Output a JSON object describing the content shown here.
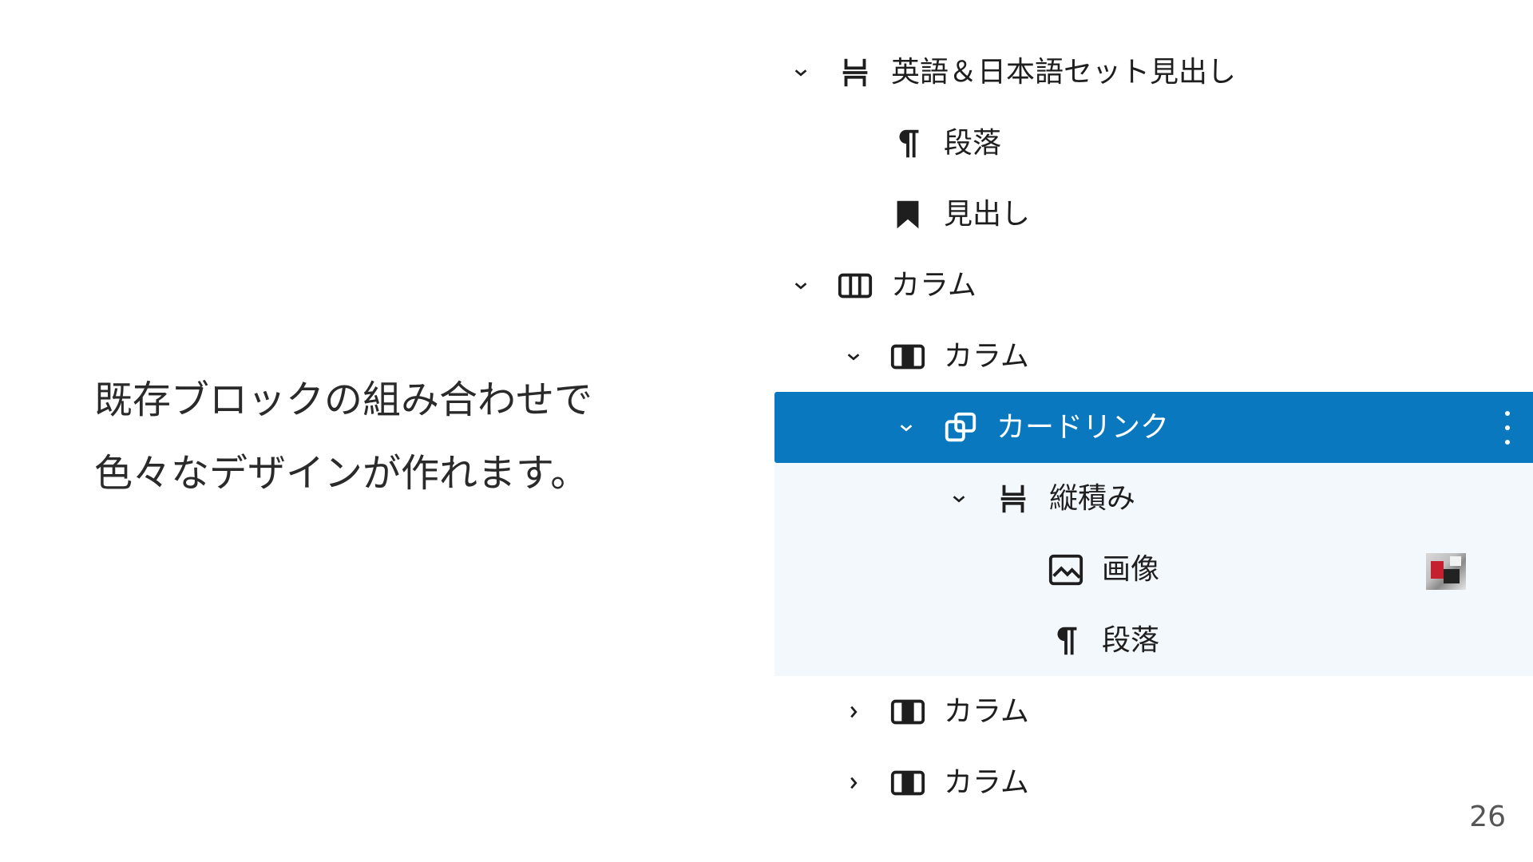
{
  "caption": {
    "line1": "既存ブロックの組み合わせで",
    "line2": "色々なデザインが作れます。"
  },
  "page_number": "26",
  "tree": [
    {
      "label": "英語＆日本語セット見出し",
      "icon": "stack-icon",
      "chevron": "down"
    },
    {
      "label": "段落",
      "icon": "paragraph-icon",
      "chevron": "none"
    },
    {
      "label": "見出し",
      "icon": "bookmark-icon",
      "chevron": "none"
    },
    {
      "label": "カラム",
      "icon": "columns-icon",
      "chevron": "down"
    },
    {
      "label": "カラム",
      "icon": "column-icon",
      "chevron": "down"
    },
    {
      "label": "カードリンク",
      "icon": "card-link-icon",
      "chevron": "down",
      "selected": true
    },
    {
      "label": "縦積み",
      "icon": "stack-icon",
      "chevron": "down"
    },
    {
      "label": "画像",
      "icon": "image-icon",
      "chevron": "none"
    },
    {
      "label": "段落",
      "icon": "paragraph-icon",
      "chevron": "none"
    },
    {
      "label": "カラム",
      "icon": "column-icon",
      "chevron": "right"
    },
    {
      "label": "カラム",
      "icon": "column-icon",
      "chevron": "right"
    }
  ],
  "colors": {
    "selected_bg": "#0a78be",
    "child_bg": "#f3f8fc"
  }
}
